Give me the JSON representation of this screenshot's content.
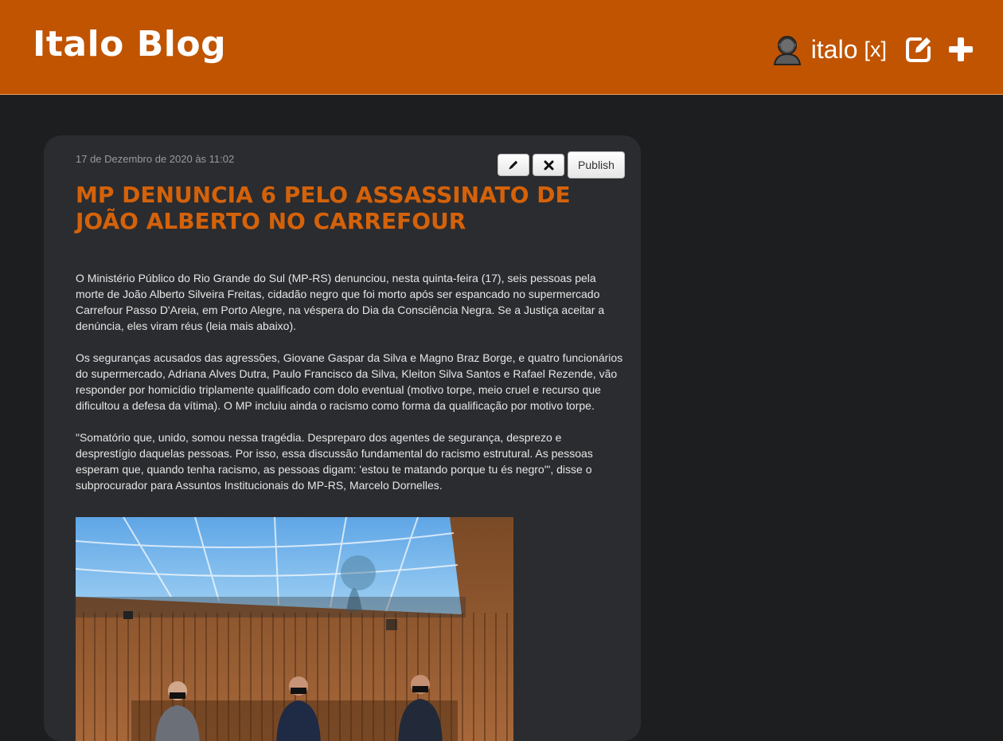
{
  "header": {
    "blog_title": "Italo Blog",
    "username": "italo",
    "logout_label": "[x]",
    "background_color": "#c05400"
  },
  "post": {
    "date": "17 de Dezembro de 2020 às 11:02",
    "title": "MP denuncia 6 pelo assassinato de João Alberto no Carrefour",
    "publish_label": "Publish",
    "paragraphs": [
      "O Ministério Público do Rio Grande do Sul (MP-RS) denunciou, nesta quinta-feira (17), seis pessoas pela morte de João Alberto Silveira Freitas, cidadão negro que foi morto após ser espancado no supermercado Carrefour Passo D'Areia, em Porto Alegre, na véspera do Dia da Consciência Negra. Se a Justiça aceitar a denúncia, eles viram réus (leia mais abaixo).",
      "Os seguranças acusados das agressões, Giovane Gaspar da Silva e Magno Braz Borge, e quatro funcionários do supermercado, Adriana Alves Dutra, Paulo Francisco da Silva, Kleiton Silva Santos e Rafael Rezende, vão responder por homicídio triplamente qualificado com dolo eventual (motivo torpe, meio cruel e recurso que dificultou a defesa da vítima). O MP incluiu ainda o racismo como forma da qualificação por motivo torpe.",
      "\"Somatório que, unido, somou nessa tragédia. Despreparo dos agentes de segurança, desprezo e desprestígio daquelas pessoas. Por isso, essa discussão fundamental do racismo estrutural. As pessoas esperam que, quando tenha racismo, as pessoas digam: 'estou te matando porque tu és negro'\", disse o subprocurador para Assuntos Institucionais do MP-RS, Marcelo Dornelles."
    ],
    "title_color": "#d4620a"
  },
  "icons": {
    "user": "user-avatar-icon",
    "edit_post": "edit-square-icon",
    "add_post": "plus-icon",
    "pencil": "pencil-icon",
    "delete": "close-x-icon"
  }
}
